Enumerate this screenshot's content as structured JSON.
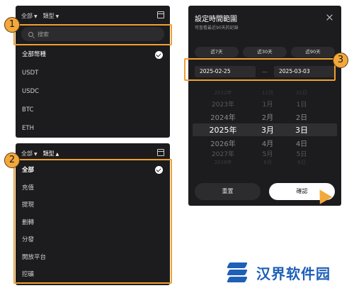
{
  "panel1": {
    "filter_all": "全部",
    "filter_type": "類型",
    "search_placeholder": "搜索",
    "items": [
      "全部幣種",
      "USDT",
      "USDC",
      "BTC",
      "ETH"
    ]
  },
  "panel2": {
    "filter_all": "全部",
    "filter_type": "類型",
    "items": [
      "全部",
      "充值",
      "提現",
      "劃轉",
      "分發",
      "開放平台",
      "挖礦"
    ]
  },
  "panel3": {
    "title": "設定時間範圍",
    "subtitle": "可查看最近90天的記錄",
    "ranges": [
      "近7天",
      "近30天",
      "近90天"
    ],
    "start_date": "2025-02-25",
    "end_date": "2025-03-03",
    "separator": "—",
    "wheel": [
      {
        "year": "2022年",
        "month": "12月",
        "day": "31日"
      },
      {
        "year": "2023年",
        "month": "1月",
        "day": "1日"
      },
      {
        "year": "2024年",
        "month": "2月",
        "day": "2日"
      },
      {
        "year": "2025年",
        "month": "3月",
        "day": "3日"
      },
      {
        "year": "2026年",
        "month": "4月",
        "day": "4日"
      },
      {
        "year": "2027年",
        "month": "5月",
        "day": "5日"
      },
      {
        "year": "2028年",
        "month": "6月",
        "day": "6日"
      }
    ],
    "reset_label": "重置",
    "confirm_label": "確認"
  },
  "callouts": [
    "1",
    "2",
    "3"
  ],
  "accent_color": "#f0a030",
  "watermark": "汉界软件园"
}
